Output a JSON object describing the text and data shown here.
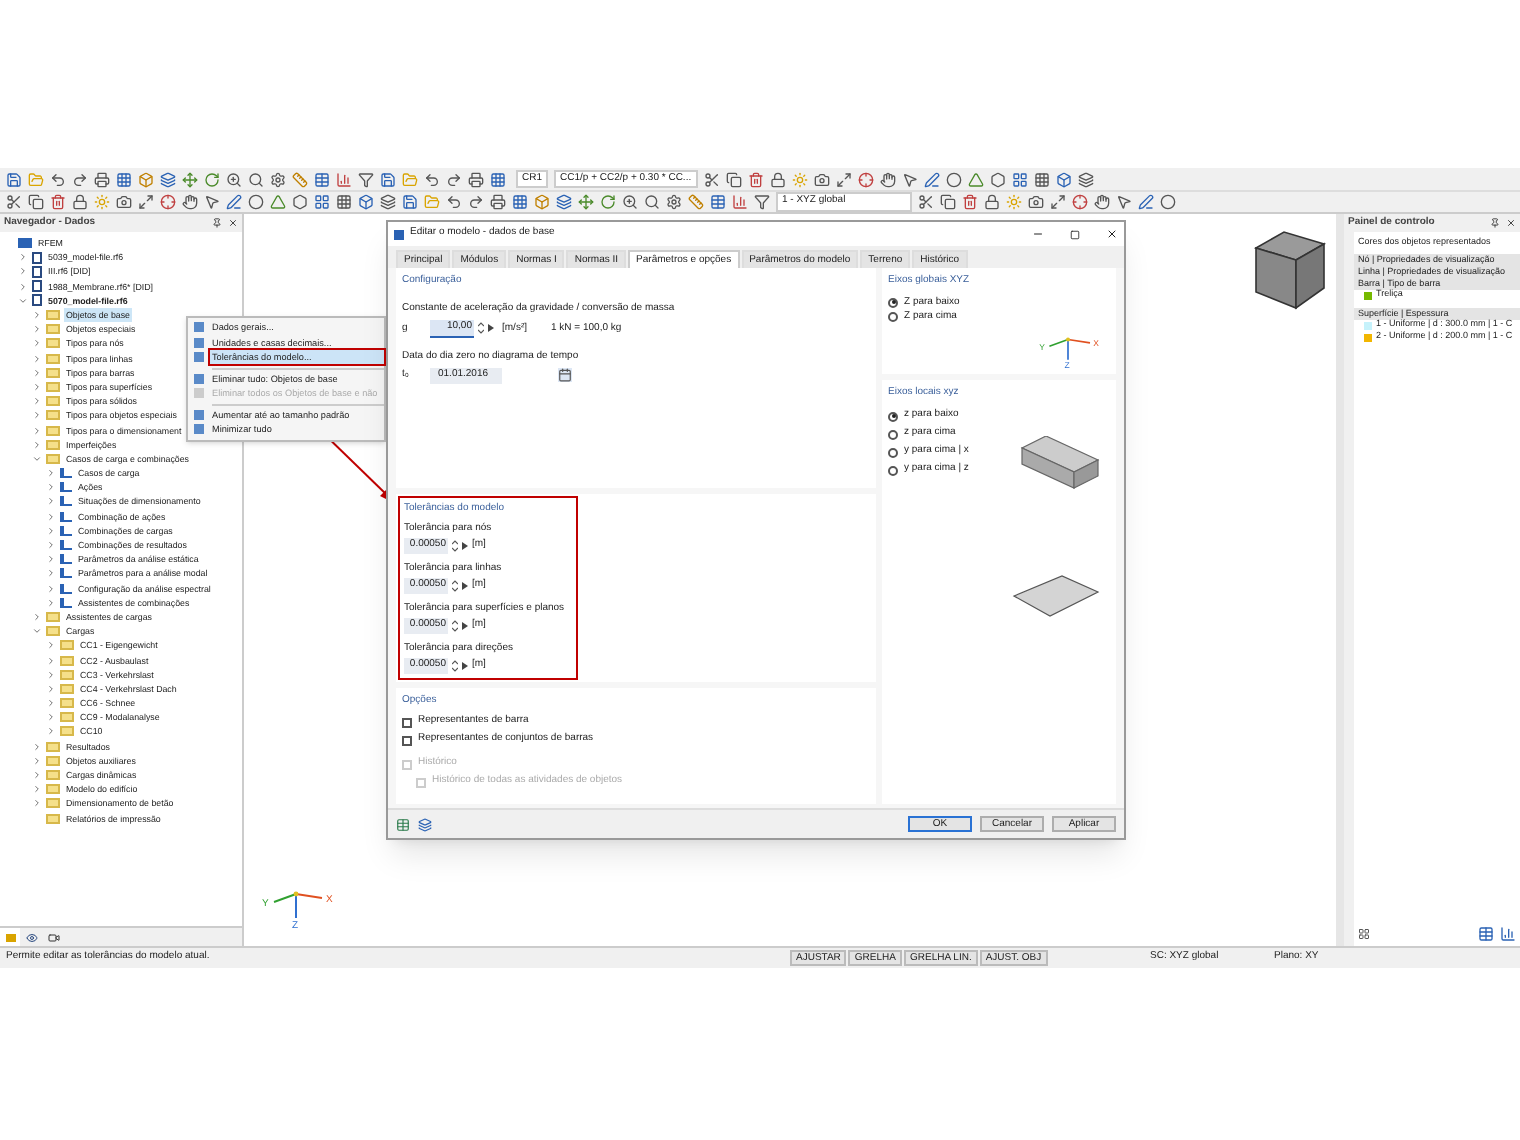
{
  "toolbar": {
    "load_case": "CR1",
    "combination": "CC1/p + CC2/p + 0.30 * CC...",
    "coordinate_system": "1 - XYZ global"
  },
  "navigator": {
    "title": "Navegador - Dados",
    "tree": [
      {
        "label": "RFEM",
        "selected": false,
        "children": [
          {
            "label": "5039_model-file.rf6",
            "expanded": false,
            "active": false,
            "selected": false
          },
          {
            "label": "III.rf6 [DID]",
            "expanded": false,
            "active": false,
            "selected": false
          },
          {
            "label": "1988_Membrane.rf6* [DID]",
            "expanded": false,
            "active": false,
            "selected": false
          },
          {
            "label": "5070_model-file.rf6",
            "expanded": true,
            "active": true,
            "selected": false,
            "children": [
              {
                "label": "Objetos de base",
                "expanded": false,
                "selected": true
              },
              {
                "label": "Objetos especiais",
                "expanded": false,
                "selected": false
              },
              {
                "label": "Tipos para nós",
                "expanded": false,
                "selected": false
              },
              {
                "label": "Tipos para linhas",
                "expanded": false,
                "selected": false
              },
              {
                "label": "Tipos para barras",
                "expanded": false,
                "selected": false
              },
              {
                "label": "Tipos para superfícies",
                "expanded": false,
                "selected": false
              },
              {
                "label": "Tipos para sólidos",
                "expanded": false,
                "selected": false
              },
              {
                "label": "Tipos para objetos especiais",
                "expanded": false,
                "selected": false
              },
              {
                "label": "Tipos para o dimensionament",
                "expanded": false,
                "selected": false
              },
              {
                "label": "Imperfeições",
                "expanded": false,
                "selected": false
              },
              {
                "label": "Casos de carga e combinações",
                "expanded": true,
                "selected": false,
                "children": [
                  {
                    "label": "Casos de carga",
                    "expanded": false,
                    "selected": false
                  },
                  {
                    "label": "Ações",
                    "expanded": false,
                    "selected": false
                  },
                  {
                    "label": "Situações de dimensionamento",
                    "expanded": false,
                    "selected": false
                  },
                  {
                    "label": "Combinação de ações",
                    "expanded": false,
                    "selected": false
                  },
                  {
                    "label": "Combinações de cargas",
                    "expanded": false,
                    "selected": false
                  },
                  {
                    "label": "Combinações de resultados",
                    "expanded": false,
                    "selected": false
                  },
                  {
                    "label": "Parâmetros da análise estática",
                    "expanded": false,
                    "selected": false
                  },
                  {
                    "label": "Parâmetros para a análise modal",
                    "expanded": false,
                    "selected": false
                  },
                  {
                    "label": "Configuração da análise espectral",
                    "expanded": false,
                    "selected": false
                  },
                  {
                    "label": "Assistentes de combinações",
                    "expanded": false,
                    "selected": false
                  }
                ]
              },
              {
                "label": "Assistentes de cargas",
                "expanded": false,
                "selected": false
              },
              {
                "label": "Cargas",
                "expanded": true,
                "selected": false,
                "children": [
                  {
                    "label": "CC1 - Eigengewicht",
                    "expanded": false,
                    "selected": false
                  },
                  {
                    "label": "CC2 - Ausbaulast",
                    "expanded": false,
                    "selected": false
                  },
                  {
                    "label": "CC3 - Verkehrslast",
                    "expanded": false,
                    "selected": false
                  },
                  {
                    "label": "CC4 - Verkehrslast Dach",
                    "expanded": false,
                    "selected": false
                  },
                  {
                    "label": "CC6 - Schnee",
                    "expanded": false,
                    "selected": false
                  },
                  {
                    "label": "CC9 - Modalanalyse",
                    "expanded": false,
                    "selected": false
                  },
                  {
                    "label": "CC10",
                    "expanded": false,
                    "selected": false
                  }
                ]
              },
              {
                "label": "Resultados",
                "expanded": false,
                "selected": false
              },
              {
                "label": "Objetos auxiliares",
                "expanded": false,
                "selected": false
              },
              {
                "label": "Cargas dinâmicas",
                "expanded": false,
                "selected": false
              },
              {
                "label": "Modelo do edifício",
                "expanded": false,
                "selected": false
              },
              {
                "label": "Dimensionamento de betão",
                "expanded": false,
                "selected": false
              },
              {
                "label": "Relatórios de impressão",
                "selected": false
              }
            ]
          }
        ]
      }
    ]
  },
  "context_menu": {
    "items": [
      {
        "label": "Dados gerais...",
        "disabled": false,
        "highlighted": false,
        "separator_before": false
      },
      {
        "label": "Unidades e casas decimais...",
        "disabled": false,
        "highlighted": false,
        "separator_before": false
      },
      {
        "label": "Tolerâncias do modelo...",
        "disabled": false,
        "highlighted": true,
        "separator_before": false
      },
      {
        "label": "Eliminar tudo: Objetos de base",
        "disabled": false,
        "highlighted": false,
        "separator_before": true
      },
      {
        "label": "Eliminar todos os Objetos de base e não",
        "disabled": true,
        "highlighted": false,
        "separator_before": false
      },
      {
        "label": "Aumentar até ao tamanho padrão",
        "disabled": false,
        "highlighted": false,
        "separator_before": true
      },
      {
        "label": "Minimizar tudo",
        "disabled": false,
        "highlighted": false,
        "separator_before": false
      }
    ]
  },
  "canvas_axes": [
    "Y",
    "X",
    "Z"
  ],
  "dialog": {
    "title": "Editar o modelo - dados de base",
    "tabs": [
      {
        "label": "Principal",
        "selected": false
      },
      {
        "label": "Módulos",
        "selected": false
      },
      {
        "label": "Normas I",
        "selected": false
      },
      {
        "label": "Normas II",
        "selected": false
      },
      {
        "label": "Parâmetros e opções",
        "selected": true
      },
      {
        "label": "Parâmetros do modelo",
        "selected": false
      },
      {
        "label": "Terreno",
        "selected": false
      },
      {
        "label": "Histórico",
        "selected": false
      }
    ],
    "configuration": {
      "title": "Configuração",
      "gravity_label": "Constante de aceleração da gravidade / conversão de massa",
      "g_symbol": "g",
      "g_value": "10,00",
      "g_unit": "[m/s²]",
      "conversion": "1 kN = 100,0 kg",
      "date_label": "Data do dia zero no diagrama de tempo",
      "t_symbol": "t₀",
      "date": "01.01.2016"
    },
    "tolerances": {
      "title": "Tolerâncias do modelo",
      "highlighted": true,
      "items": [
        {
          "label": "Tolerância para nós",
          "value": "0.00050",
          "unit": "[m]"
        },
        {
          "label": "Tolerância para linhas",
          "value": "0.00050",
          "unit": "[m]"
        },
        {
          "label": "Tolerância para superfícies e planos",
          "value": "0.00050",
          "unit": "[m]"
        },
        {
          "label": "Tolerância para direções",
          "value": "0.00050",
          "unit": "[m]"
        }
      ]
    },
    "options": {
      "title": "Opções",
      "items": [
        {
          "label": "Representantes de barra",
          "checked": false,
          "disabled": false
        },
        {
          "label": "Representantes de conjuntos de barras",
          "checked": false,
          "disabled": false
        },
        {
          "label": "Histórico",
          "checked": false,
          "disabled": true,
          "children": [
            {
              "label": "Histórico de todas as atividades de objetos",
              "checked": false,
              "disabled": true
            }
          ]
        }
      ]
    },
    "global_axes": {
      "title": "Eixos globais XYZ",
      "options": [
        {
          "label": "Z para baixo",
          "selected": true
        },
        {
          "label": "Z para cima",
          "selected": false
        }
      ],
      "axis_labels": [
        "Y",
        "X",
        "Z"
      ]
    },
    "local_axes": {
      "title": "Eixos locais xyz",
      "options": [
        {
          "label": "z para baixo",
          "selected": true
        },
        {
          "label": "z para cima",
          "selected": false
        },
        {
          "label": "y para cima | x",
          "selected": false
        },
        {
          "label": "y para cima | z",
          "selected": false
        }
      ]
    },
    "buttons": [
      {
        "label": "OK",
        "default": true
      },
      {
        "label": "Cancelar",
        "default": false
      },
      {
        "label": "Aplicar",
        "default": false
      }
    ]
  },
  "control_panel": {
    "title": "Painel de controlo",
    "subtitle": "Cores dos objetos representados",
    "rows": [
      {
        "kind": "band",
        "label": "Nó | Propriedades de visualização"
      },
      {
        "kind": "band",
        "label": "Linha | Propriedades de visualização"
      },
      {
        "kind": "group",
        "label": "Barra | Tipo de barra",
        "children": [
          {
            "label": "Treliça",
            "color": "#76b900"
          }
        ]
      },
      {
        "kind": "group",
        "label": "Superfície | Espessura",
        "children": [
          {
            "label": "1 - Uniforme | d : 300.0 mm | 1 - C",
            "color": "#c6f2fb"
          },
          {
            "label": "2 - Uniforme | d : 200.0 mm | 1 - C",
            "color": "#f2b600"
          }
        ]
      }
    ]
  },
  "status_bar": {
    "message": "Permite editar as tolerâncias do modelo atual.",
    "toggles": [
      "AJUSTAR",
      "GRELHA",
      "GRELHA LIN.",
      "AJUST. OBJ"
    ],
    "coordinate_system": "SC: XYZ global",
    "plane": "Plano: XY"
  }
}
